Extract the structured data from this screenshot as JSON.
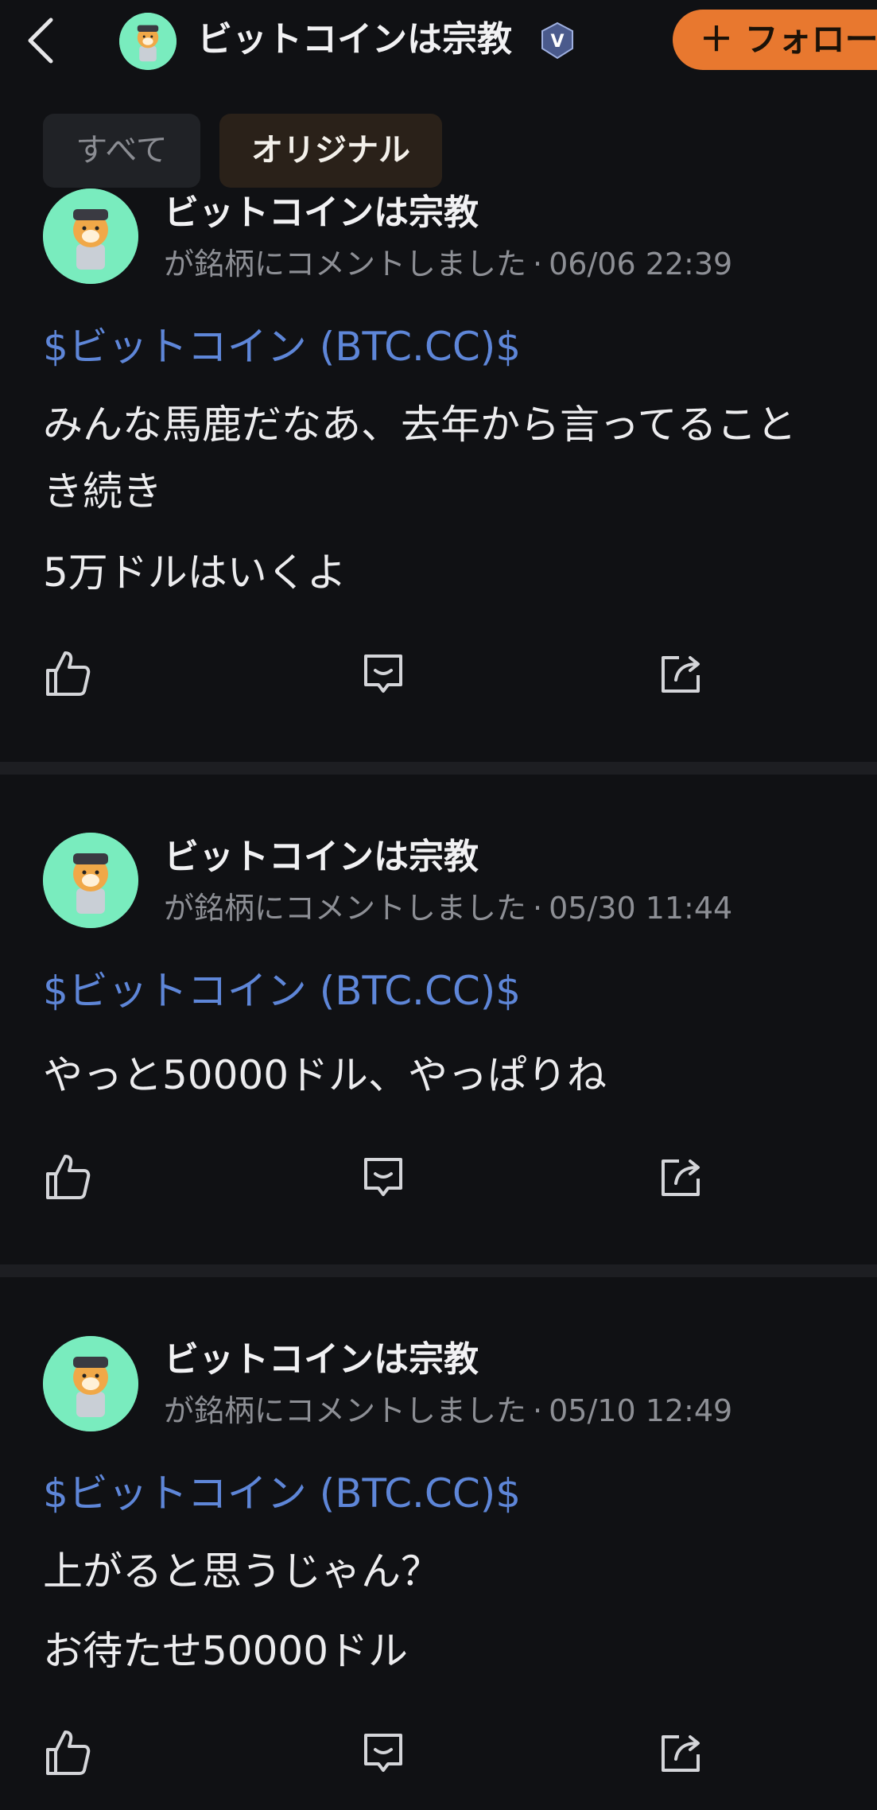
{
  "header": {
    "back_icon": "chevron-left-icon",
    "title": "ビットコインは宗教",
    "badge_icon": "vip-badge-icon",
    "follow_label": "＋ フォロー"
  },
  "tabs": [
    {
      "label": "すべて",
      "active": false
    },
    {
      "label": "オリジナル",
      "active": true
    }
  ],
  "posts": [
    {
      "author": "ビットコインは宗教",
      "action_text": "が銘柄にコメントしました",
      "separator": "·",
      "timestamp": "06/06 22:39",
      "ticker": "$ビットコイン (BTC.CC)$",
      "lines": [
        "みんな馬鹿だなあ、去年から言ってること",
        "き続き",
        "5万ドルはいくよ"
      ]
    },
    {
      "author": "ビットコインは宗教",
      "action_text": "が銘柄にコメントしました",
      "separator": "·",
      "timestamp": "05/30 11:44",
      "ticker": "$ビットコイン (BTC.CC)$",
      "lines": [
        "やっと50000ドル、やっぱりね"
      ]
    },
    {
      "author": "ビットコインは宗教",
      "action_text": "が銘柄にコメントしました",
      "separator": "·",
      "timestamp": "05/10 12:49",
      "ticker": "$ビットコイン (BTC.CC)$",
      "lines": [
        "上がると思うじゃん？",
        "お待たせ50000ドル"
      ]
    }
  ],
  "actions": [
    "like-icon",
    "comment-icon",
    "share-icon"
  ],
  "colors": {
    "background": "#101114",
    "accent_orange": "#e8782f",
    "ticker_blue": "#5e86d8",
    "avatar_bg": "#79ecbe"
  }
}
